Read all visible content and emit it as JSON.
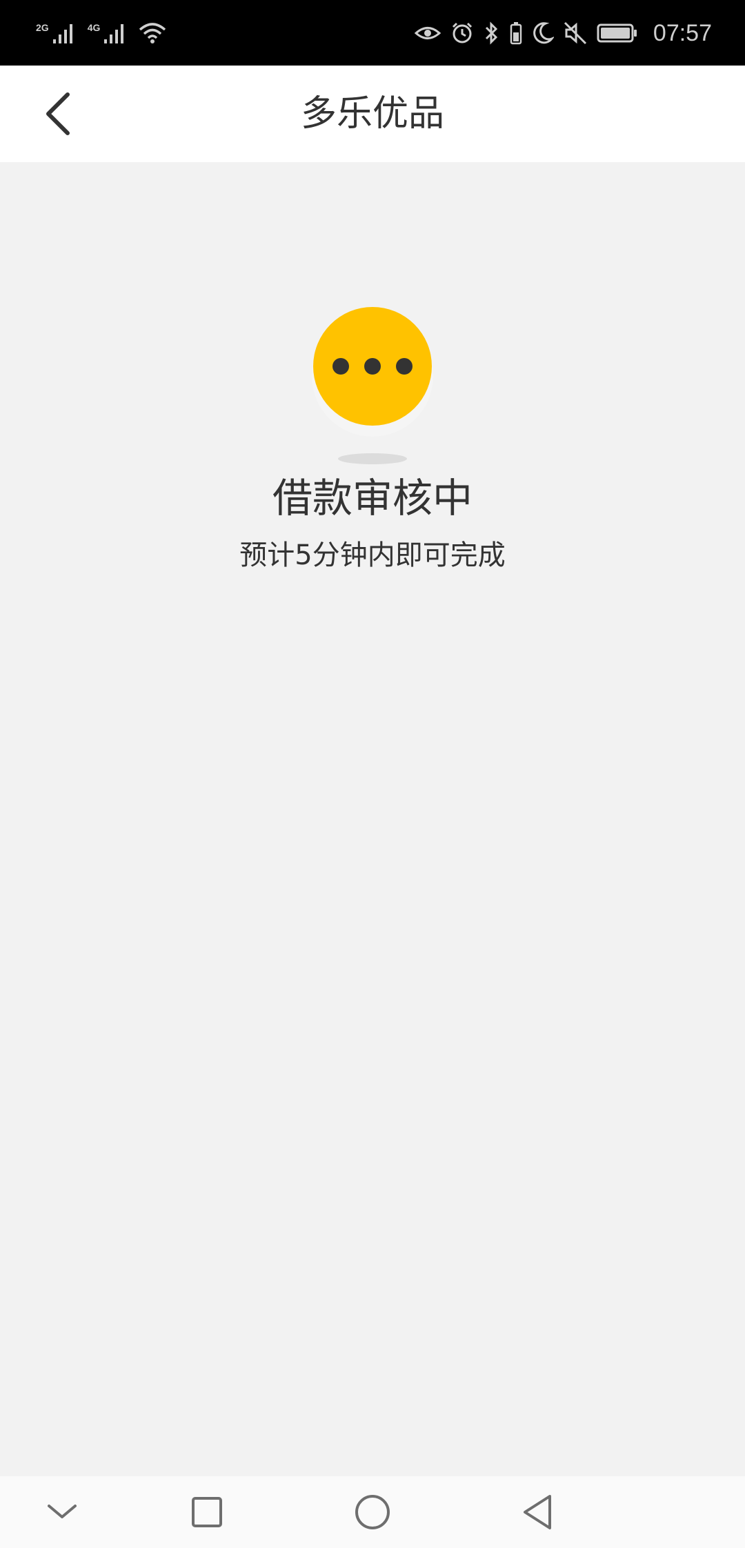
{
  "status_bar": {
    "network_1": "2G",
    "network_2": "4G",
    "time": "07:57"
  },
  "header": {
    "title": "多乐优品"
  },
  "status": {
    "title": "借款审核中",
    "subtitle": "预计5分钟内即可完成"
  },
  "colors": {
    "accent": "#ffc200",
    "background": "#f2f2f2",
    "header_bg": "#ffffff",
    "text": "#333333"
  },
  "icons": {
    "back": "chevron-left-icon",
    "pending": "pending-dots-icon",
    "nav": [
      "chevron-down-icon",
      "square-icon",
      "circle-icon",
      "triangle-back-icon"
    ]
  }
}
